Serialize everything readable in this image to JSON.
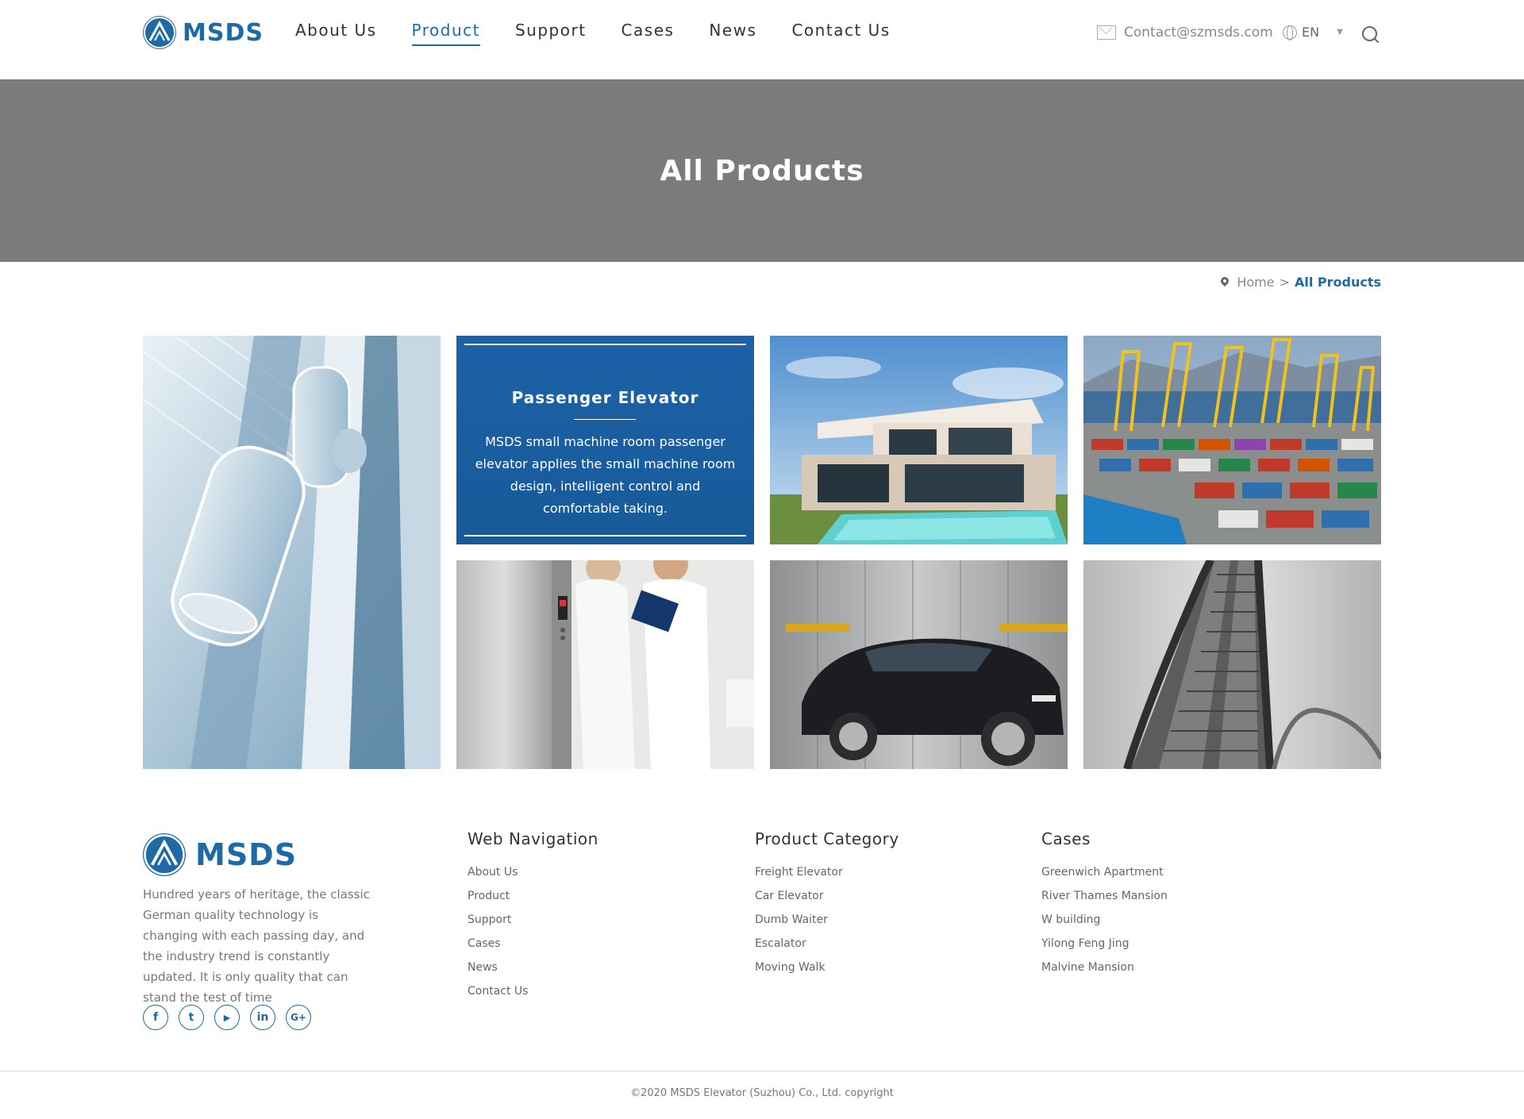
{
  "brand": {
    "name": "MSDS",
    "color": "#1e6aa6"
  },
  "nav": {
    "items": [
      {
        "label": "About Us",
        "active": false
      },
      {
        "label": "Product",
        "active": true
      },
      {
        "label": "Support",
        "active": false
      },
      {
        "label": "Cases",
        "active": false
      },
      {
        "label": "News",
        "active": false
      },
      {
        "label": "Contact Us",
        "active": false
      }
    ]
  },
  "header": {
    "email": "Contact@szmsds.com",
    "language": "EN",
    "mail_icon": "mail-icon",
    "globe_icon": "globe-icon",
    "search_icon": "search-icon"
  },
  "banner": {
    "title": "All Products"
  },
  "breadcrumb": {
    "home": "Home",
    "separator": ">",
    "current": "All Products"
  },
  "products": {
    "feature": {
      "title": "Passenger Elevator",
      "description": "MSDS small machine room passenger elevator applies the small machine room design, intelligent control and comfortable taking."
    },
    "images": [
      "observation elevator photo",
      "modern villa with pool photo",
      "container port cranes photo",
      "medical staff by elevator photo",
      "car in freight elevator photo",
      "escalators photo"
    ]
  },
  "footer": {
    "brand": "MSDS",
    "description": "Hundred years of heritage, the classic German quality technology is changing with each passing day, and the industry trend is constantly updated. It is only quality that can stand the test of time",
    "social": [
      {
        "icon": "facebook-icon",
        "glyph": "f"
      },
      {
        "icon": "twitter-icon",
        "glyph": "t"
      },
      {
        "icon": "youtube-icon",
        "glyph": "▶"
      },
      {
        "icon": "linkedin-icon",
        "glyph": "in"
      },
      {
        "icon": "google-plus-icon",
        "glyph": "G+"
      }
    ],
    "columns": [
      {
        "title": "Web Navigation",
        "items": [
          "About Us",
          "Product",
          "Support",
          "Cases",
          "News",
          "Contact Us"
        ]
      },
      {
        "title": "Product Category",
        "items": [
          "Freight Elevator",
          "Car Elevator",
          "Dumb Waiter",
          "Escalator",
          "Moving Walk"
        ]
      },
      {
        "title": "Cases",
        "items": [
          "Greenwich Apartment",
          "River Thames Mansion",
          "W building",
          "Yilong Feng Jing",
          "Malvine Mansion"
        ]
      }
    ],
    "copyright": "©2020 MSDS Elevator (Suzhou) Co., Ltd. copyright"
  }
}
